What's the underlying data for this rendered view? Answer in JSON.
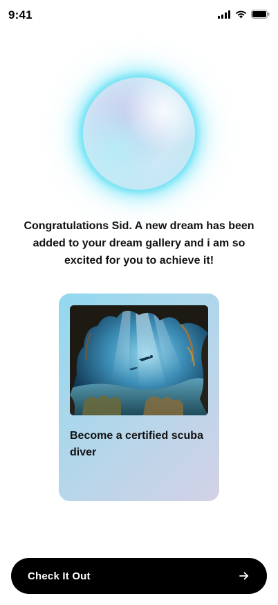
{
  "status_bar": {
    "time": "9:41",
    "icons": [
      "cellular-signal-icon",
      "wifi-icon",
      "battery-icon"
    ]
  },
  "orb": {
    "icon": "glowing-orb-icon",
    "glow_color": "#52DEF5"
  },
  "message": {
    "text": "Congratulations Sid. A new dream has been added to your dream gallery and i am so excited for you to achieve it!"
  },
  "dream_card": {
    "image": "underwater-cave-scuba-diver-photo",
    "title": "Become a certified scuba diver",
    "gradient_colors": [
      "#92D8EF",
      "#D3D1E6"
    ]
  },
  "cta": {
    "label": "Check It Out",
    "icon": "arrow-right-icon",
    "background": "#000000",
    "text_color": "#FFFFFF"
  }
}
